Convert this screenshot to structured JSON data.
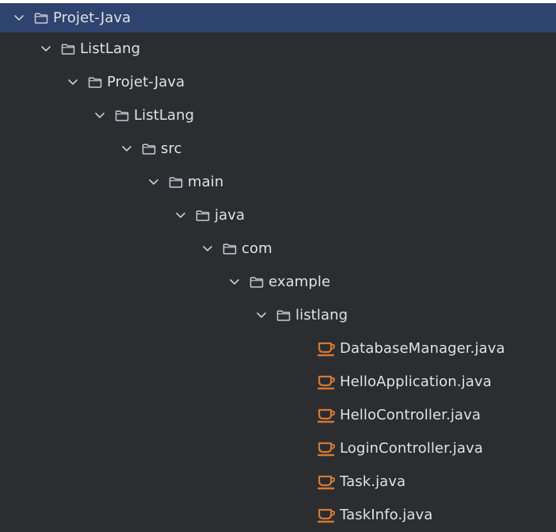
{
  "tree": {
    "nodes": [
      {
        "type": "folder",
        "label": "Projet-Java",
        "depth": 0,
        "selected": true
      },
      {
        "type": "folder",
        "label": "ListLang",
        "depth": 1
      },
      {
        "type": "folder",
        "label": "Projet-Java",
        "depth": 2
      },
      {
        "type": "folder",
        "label": "ListLang",
        "depth": 3
      },
      {
        "type": "folder",
        "label": "src",
        "depth": 4
      },
      {
        "type": "folder",
        "label": "main",
        "depth": 5
      },
      {
        "type": "folder",
        "label": "java",
        "depth": 6
      },
      {
        "type": "folder",
        "label": "com",
        "depth": 7
      },
      {
        "type": "folder",
        "label": "example",
        "depth": 8
      },
      {
        "type": "folder",
        "label": "listlang",
        "depth": 9
      },
      {
        "type": "file",
        "label": "DatabaseManager.java",
        "depth": 10
      },
      {
        "type": "file",
        "label": "HelloApplication.java",
        "depth": 10
      },
      {
        "type": "file",
        "label": "HelloController.java",
        "depth": 10
      },
      {
        "type": "file",
        "label": "LoginController.java",
        "depth": 10
      },
      {
        "type": "file",
        "label": "Task.java",
        "depth": 10
      },
      {
        "type": "file",
        "label": "TaskInfo.java",
        "depth": 10
      }
    ]
  },
  "icons": {
    "folder": "folder-icon",
    "chevron": "chevron-down-icon",
    "file": "java-class-icon"
  },
  "colors": {
    "panel_bg": "#2b2d30",
    "selected_bg": "#2e436e",
    "text": "#dfe1e5",
    "icon_gray": "#c9ccd1",
    "java_orange": "#d47833"
  }
}
